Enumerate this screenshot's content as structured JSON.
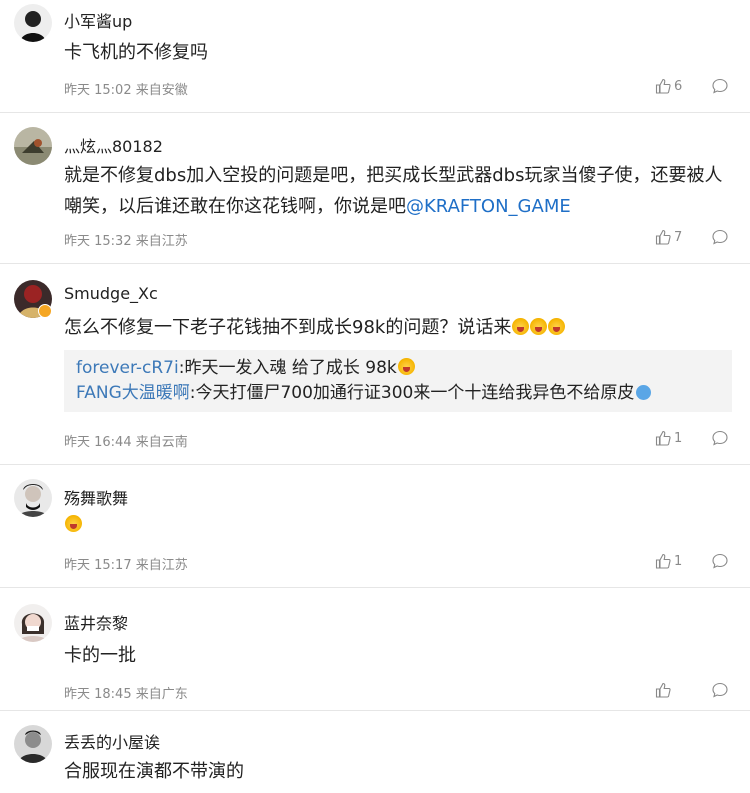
{
  "comments": [
    {
      "username": "小军酱up",
      "text": "卡飞机的不修复吗",
      "time": "昨天 15:02",
      "source": "来自安徽",
      "likes": "6"
    },
    {
      "username": "‪灬炫灬80182",
      "text": "就是不修复dbs加入空投的问题是吧，把买成长型武器dbs玩家当傻子使，还要被人嘲笑，以后谁还敢在你这花钱啊，你说是吧",
      "mention": "@KRAFTON_GAME",
      "time": "昨天 15:32",
      "source": "来自江苏",
      "likes": "7"
    },
    {
      "username": "Smudge_Xc",
      "text": "怎么不修复一下老子花钱抽不到成长98k的问题？说话来",
      "time": "昨天 16:44",
      "source": "来自云南",
      "likes": "1",
      "replies": [
        {
          "who": "forever-cR7i",
          "text": ":昨天一发入魂 给了成长 98k"
        },
        {
          "who": "FANG大温暖啊",
          "text": ":今天打僵尸700加通行证300来一个十连给我异色不给原皮"
        }
      ]
    },
    {
      "username": "殇舞歌舞",
      "text": "",
      "time": "昨天 15:17",
      "source": "来自江苏",
      "likes": "1"
    },
    {
      "username": "蓝井奈黎",
      "text": "卡的一批",
      "time": "昨天 18:45",
      "source": "来自广东",
      "likes": ""
    },
    {
      "username": "丢丢的小屋诶",
      "text": "合服现在演都不带演的"
    }
  ]
}
